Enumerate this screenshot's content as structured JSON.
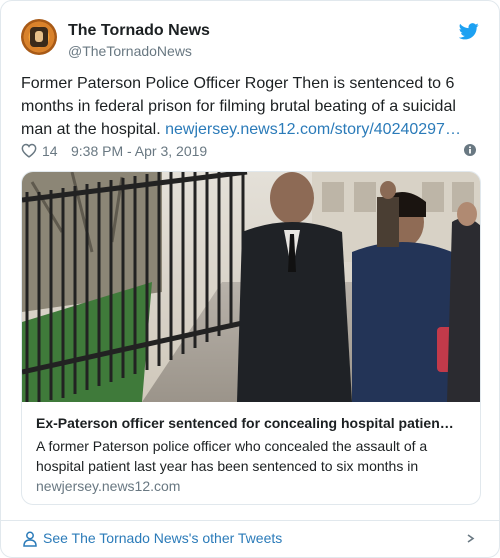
{
  "header": {
    "display_name": "The Tornado News",
    "handle": "@TheTornadoNews",
    "avatar_icon": "tornado-news-logo",
    "platform_icon": "twitter-bird-icon",
    "brand_color": "#1da1f2"
  },
  "tweet": {
    "text": "Former Paterson Police Officer Roger Then is sentenced to 6 months in federal prison for filming brutal beating of a suicidal man at the hospital.",
    "link": "newjersey.news12.com/story/40240297…",
    "likes": "14",
    "timestamp": "9:38 PM - Apr 3, 2019"
  },
  "card": {
    "title": "Ex-Paterson officer sentenced for concealing hospital patien…",
    "description": "A former Paterson police officer who concealed the assault of a hospital patient last year has been sentenced to six months in",
    "domain": "newjersey.news12.com"
  },
  "footer": {
    "label": "See The Tornado News's other Tweets"
  },
  "colors": {
    "link": "#2b7bb9",
    "muted": "#697882",
    "border": "#e1e8ed"
  }
}
